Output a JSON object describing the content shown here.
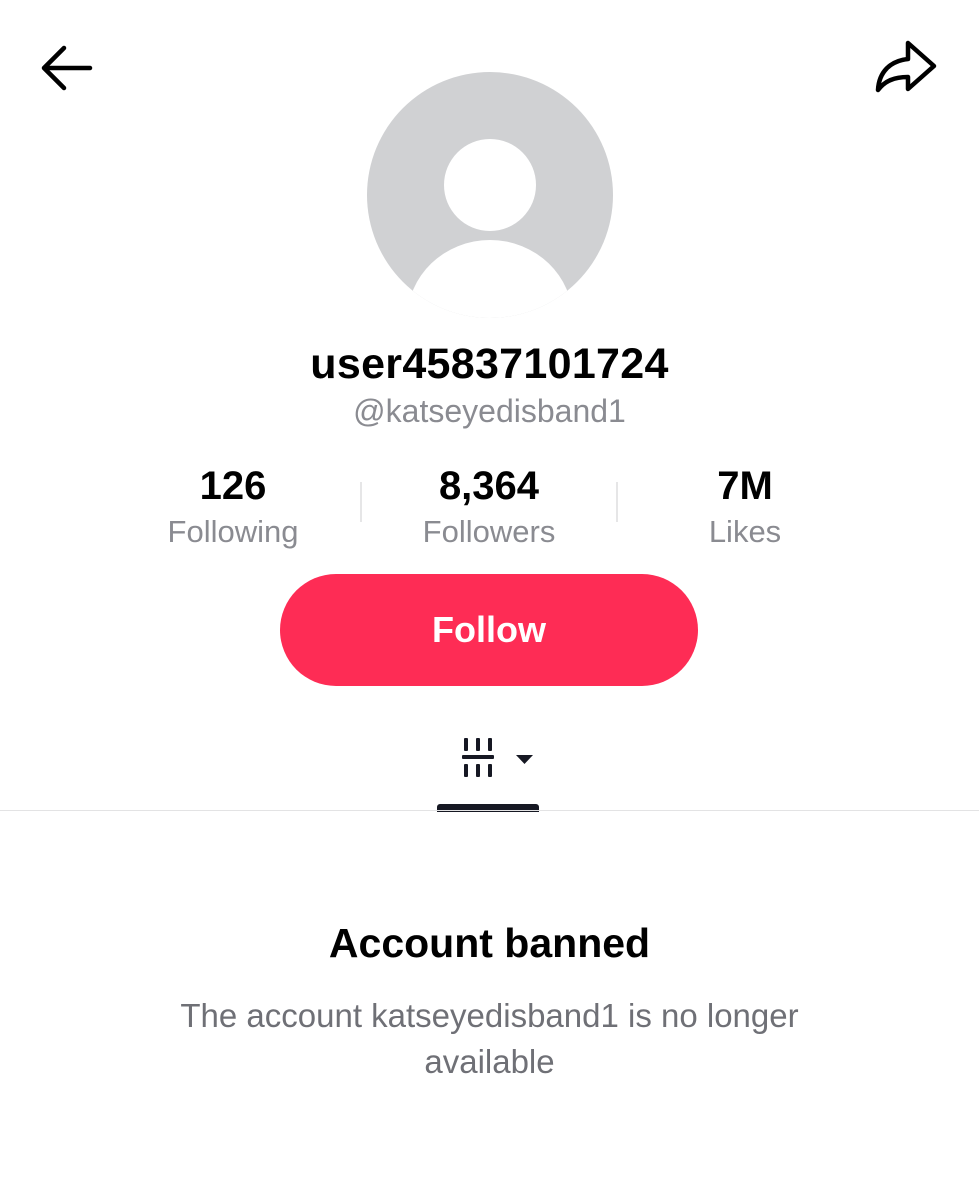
{
  "header": {
    "back_icon": "arrow-left-icon",
    "share_icon": "share-arrow-icon"
  },
  "profile": {
    "avatar_icon": "default-avatar-icon",
    "display_name": "user45837101724",
    "handle": "@katseyedisband1"
  },
  "stats": [
    {
      "value": "126",
      "label": "Following"
    },
    {
      "value": "8,364",
      "label": "Followers"
    },
    {
      "value": "7M",
      "label": "Likes"
    }
  ],
  "actions": {
    "follow_label": "Follow",
    "accent_color": "#fe2c55"
  },
  "tabs": {
    "videos_icon": "grid-with-dropdown-icon"
  },
  "ban_notice": {
    "title": "Account banned",
    "message": "The account katseyedisband1 is no longer available"
  }
}
